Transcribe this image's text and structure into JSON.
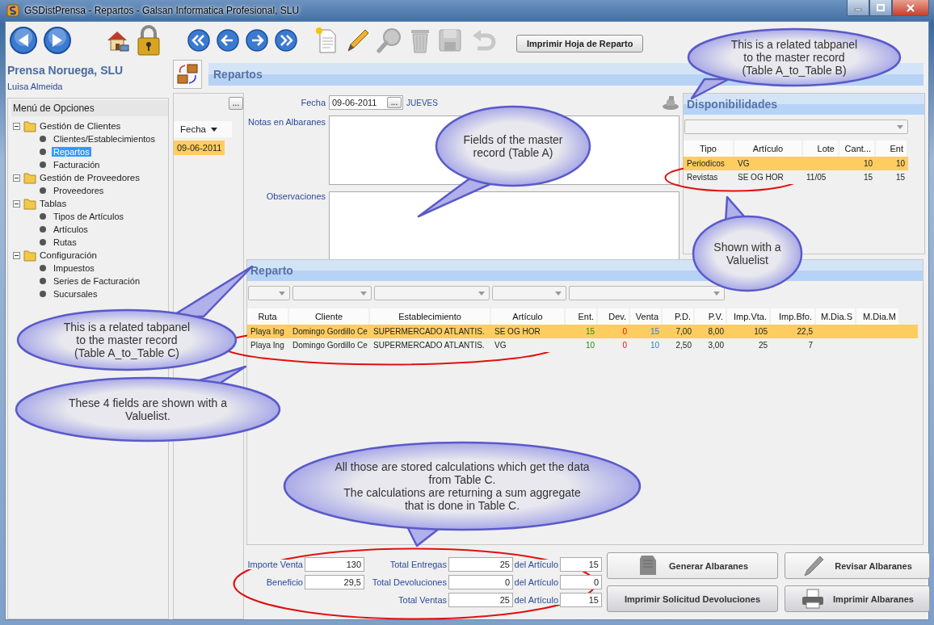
{
  "window": {
    "title": "GSDistPrensa - Repartos - Galsan Informatica Profesional, SLU"
  },
  "toolbar": {
    "icons": [
      {
        "kind": "back",
        "disabled": false
      },
      {
        "kind": "forward",
        "disabled": false
      },
      {
        "kind": "home",
        "disabled": false
      },
      {
        "kind": "lock",
        "disabled": false
      },
      {
        "kind": "first",
        "disabled": false
      },
      {
        "kind": "previous",
        "disabled": false
      },
      {
        "kind": "next",
        "disabled": false
      },
      {
        "kind": "last",
        "disabled": false
      },
      {
        "kind": "new",
        "disabled": false
      },
      {
        "kind": "edit",
        "disabled": false
      },
      {
        "kind": "search",
        "disabled": true
      },
      {
        "kind": "delete",
        "disabled": true
      },
      {
        "kind": "save",
        "disabled": true
      },
      {
        "kind": "undo",
        "disabled": true
      }
    ],
    "print_button": "Imprimir Hoja de Reparto"
  },
  "company": "Prensa Noruega, SLU",
  "user": "Luisa Almeida",
  "menu": {
    "title": "Menú de Opciones",
    "groups": [
      {
        "label": "Gestión de Clientes",
        "expanded": true,
        "children": [
          {
            "label": "Clientes/Establecimientos",
            "selected": false
          },
          {
            "label": "Repartos",
            "selected": true
          },
          {
            "label": "Facturación",
            "selected": false
          }
        ]
      },
      {
        "label": "Gestión de Proveedores",
        "expanded": true,
        "children": [
          {
            "label": "Proveedores",
            "selected": false
          }
        ]
      },
      {
        "label": "Tablas",
        "expanded": true,
        "children": [
          {
            "label": "Tipos de Artículos",
            "selected": false
          },
          {
            "label": "Artículos",
            "selected": false
          },
          {
            "label": "Rutas",
            "selected": false
          }
        ]
      },
      {
        "label": "Configuración",
        "expanded": true,
        "children": [
          {
            "label": "Impuestos",
            "selected": false
          },
          {
            "label": "Series de Facturación",
            "selected": false
          },
          {
            "label": "Sucursales",
            "selected": false
          }
        ]
      }
    ]
  },
  "section_title": "Repartos",
  "record_list": {
    "button": "...",
    "column": "Fecha",
    "rows": [
      {
        "value": "09-06-2011",
        "selected": true
      }
    ]
  },
  "master": {
    "fecha_label": "Fecha",
    "fecha": "09-06-2011",
    "date_button": "...",
    "weekday": "JUEVES",
    "notas_label": "Notas en Albaranes",
    "observaciones_label": "Observaciones"
  },
  "disponibilidades": {
    "title": "Disponibilidades",
    "columns": [
      "Tipo",
      "Artículo",
      "Lote",
      "Cant...",
      "Ent"
    ],
    "rows": [
      {
        "tipo": "Periodicos",
        "articulo": "VG",
        "cantidad": "10",
        "ent": "10",
        "selected": true
      },
      {
        "tipo": "Revistas",
        "articulo": "SE OG HOR",
        "lote": "11/05",
        "cantidad": "15",
        "ent": "15",
        "selected": false
      }
    ]
  },
  "reparto": {
    "title": "Reparto",
    "columns": [
      "Ruta",
      "Cliente",
      "Establecimiento",
      "Artículo",
      "Ent.",
      "Dev.",
      "Venta",
      "P.D.",
      "P.V.",
      "Imp.Vta.",
      "Imp.Bfo.",
      "M.Dia.S",
      "M.Dia.M"
    ],
    "rows": [
      {
        "cells": [
          "Playa Ing",
          "Domingo Gordillo Ce",
          "SUPERMERCADO ATLANTIS.",
          "SE OG HOR",
          "15",
          "0",
          "15",
          "7,00",
          "8,00",
          "105",
          "22,5"
        ],
        "selected": true
      },
      {
        "cells": [
          "Playa Ing",
          "Domingo Gordillo Ce",
          "SUPERMERCADO ATLANTIS.",
          "VG",
          "10",
          "0",
          "10",
          "2,50",
          "3,00",
          "25",
          "7"
        ],
        "selected": false
      }
    ]
  },
  "totals": {
    "rows": [
      [
        {
          "label": "Importe Venta",
          "value": "130"
        },
        {
          "label": "Total Entregas",
          "value": "25"
        },
        {
          "label": "del Artículo",
          "value": "15"
        }
      ],
      [
        {
          "label": "Beneficio",
          "value": "29,5"
        },
        {
          "label": "Total Devoluciones",
          "value": "0"
        },
        {
          "label": "del Artículo",
          "value": "0"
        }
      ],
      [
        "",
        {
          "label": "Total Ventas",
          "value": "25"
        },
        {
          "label": "del Artículo",
          "value": "15"
        }
      ]
    ]
  },
  "buttons": [
    {
      "label": "Generar Albaranes",
      "kind": "stamp"
    },
    {
      "label": "Revisar Albaranes",
      "kind": "pencil"
    },
    {
      "label": "Imprimir Solicitud Devoluciones",
      "kind": "plain"
    },
    {
      "label": "Imprimir Albaranes",
      "kind": "printer"
    }
  ],
  "callouts": [
    {
      "lines": [
        "This is a related tabpanel",
        "to the master record",
        "(Table A_to_Table B)"
      ]
    },
    {
      "lines": [
        "Fields of the master",
        "record (Table A)"
      ]
    },
    {
      "lines": [
        "This is a related tabpanel",
        "to the master record",
        "(Table A_to_Table C)"
      ]
    },
    {
      "lines": [
        "Shown with a",
        "Valuelist"
      ]
    },
    {
      "lines": [
        "These 4 fields are shown with a",
        "Valuelist."
      ]
    },
    {
      "lines": [
        "All those are stored calculations which get the data",
        "from Table C.",
        "The calculations are returning a sum aggregate",
        "that is done in Table C."
      ]
    }
  ]
}
